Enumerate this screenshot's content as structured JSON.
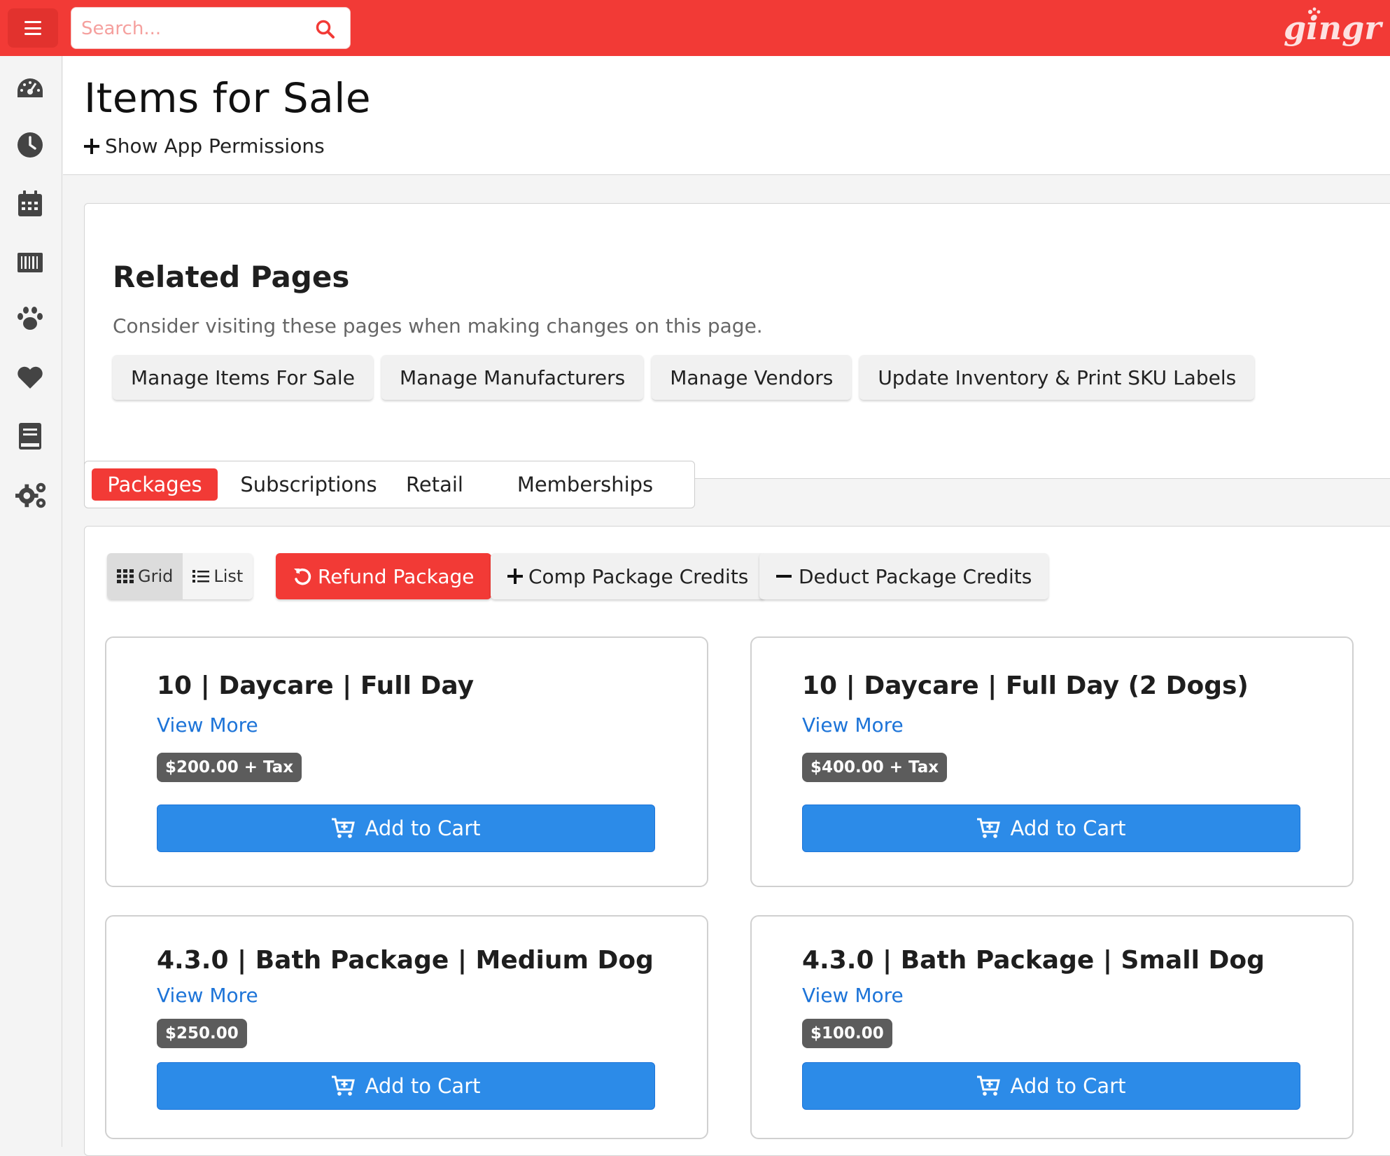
{
  "topbar": {
    "menu_icon": "hamburger-menu-icon",
    "search_placeholder": "Search...",
    "search_icon": "search-icon",
    "brand": "gingr",
    "brand_color": "#f23a36"
  },
  "sidebar": {
    "items": [
      {
        "icon": "dashboard-gauge-icon"
      },
      {
        "icon": "clock-icon"
      },
      {
        "icon": "calendar-icon"
      },
      {
        "icon": "barcode-icon"
      },
      {
        "icon": "paw-icon"
      },
      {
        "icon": "heart-icon"
      },
      {
        "icon": "book-icon"
      },
      {
        "icon": "settings-gears-icon"
      }
    ]
  },
  "header": {
    "title": "Items for Sale",
    "permissions_toggle": "Show App Permissions"
  },
  "related": {
    "heading": "Related Pages",
    "description": "Consider visiting these pages when making changes on this page.",
    "buttons": [
      "Manage Items For Sale",
      "Manage Manufacturers",
      "Manage Vendors",
      "Update Inventory & Print SKU Labels"
    ]
  },
  "tabs": {
    "items": [
      "Packages",
      "Subscriptions",
      "Retail",
      "Memberships"
    ],
    "active": "Packages"
  },
  "toolbar": {
    "grid_label": "Grid",
    "list_label": "List",
    "active_view": "Grid",
    "refund_label": "Refund Package",
    "comp_label": "Comp Package Credits",
    "deduct_label": "Deduct Package Credits"
  },
  "packages": [
    {
      "title": "10 | Daycare | Full Day",
      "link": "View More",
      "price": "$200.00 + Tax",
      "cart": "Add to Cart"
    },
    {
      "title": "10 | Daycare | Full Day (2 Dogs)",
      "link": "View More",
      "price": "$400.00 + Tax",
      "cart": "Add to Cart"
    },
    {
      "title": "4.3.0 | Bath Package | Medium Dog",
      "link": "View More",
      "price": "$250.00",
      "cart": "Add to Cart"
    },
    {
      "title": "4.3.0 | Bath Package | Small Dog",
      "link": "View More",
      "price": "$100.00",
      "cart": "Add to Cart"
    }
  ],
  "colors": {
    "accent_red": "#f23a36",
    "primary_blue": "#2c8be8",
    "link_blue": "#1d74d8",
    "badge_grey": "#5c5c5c"
  }
}
